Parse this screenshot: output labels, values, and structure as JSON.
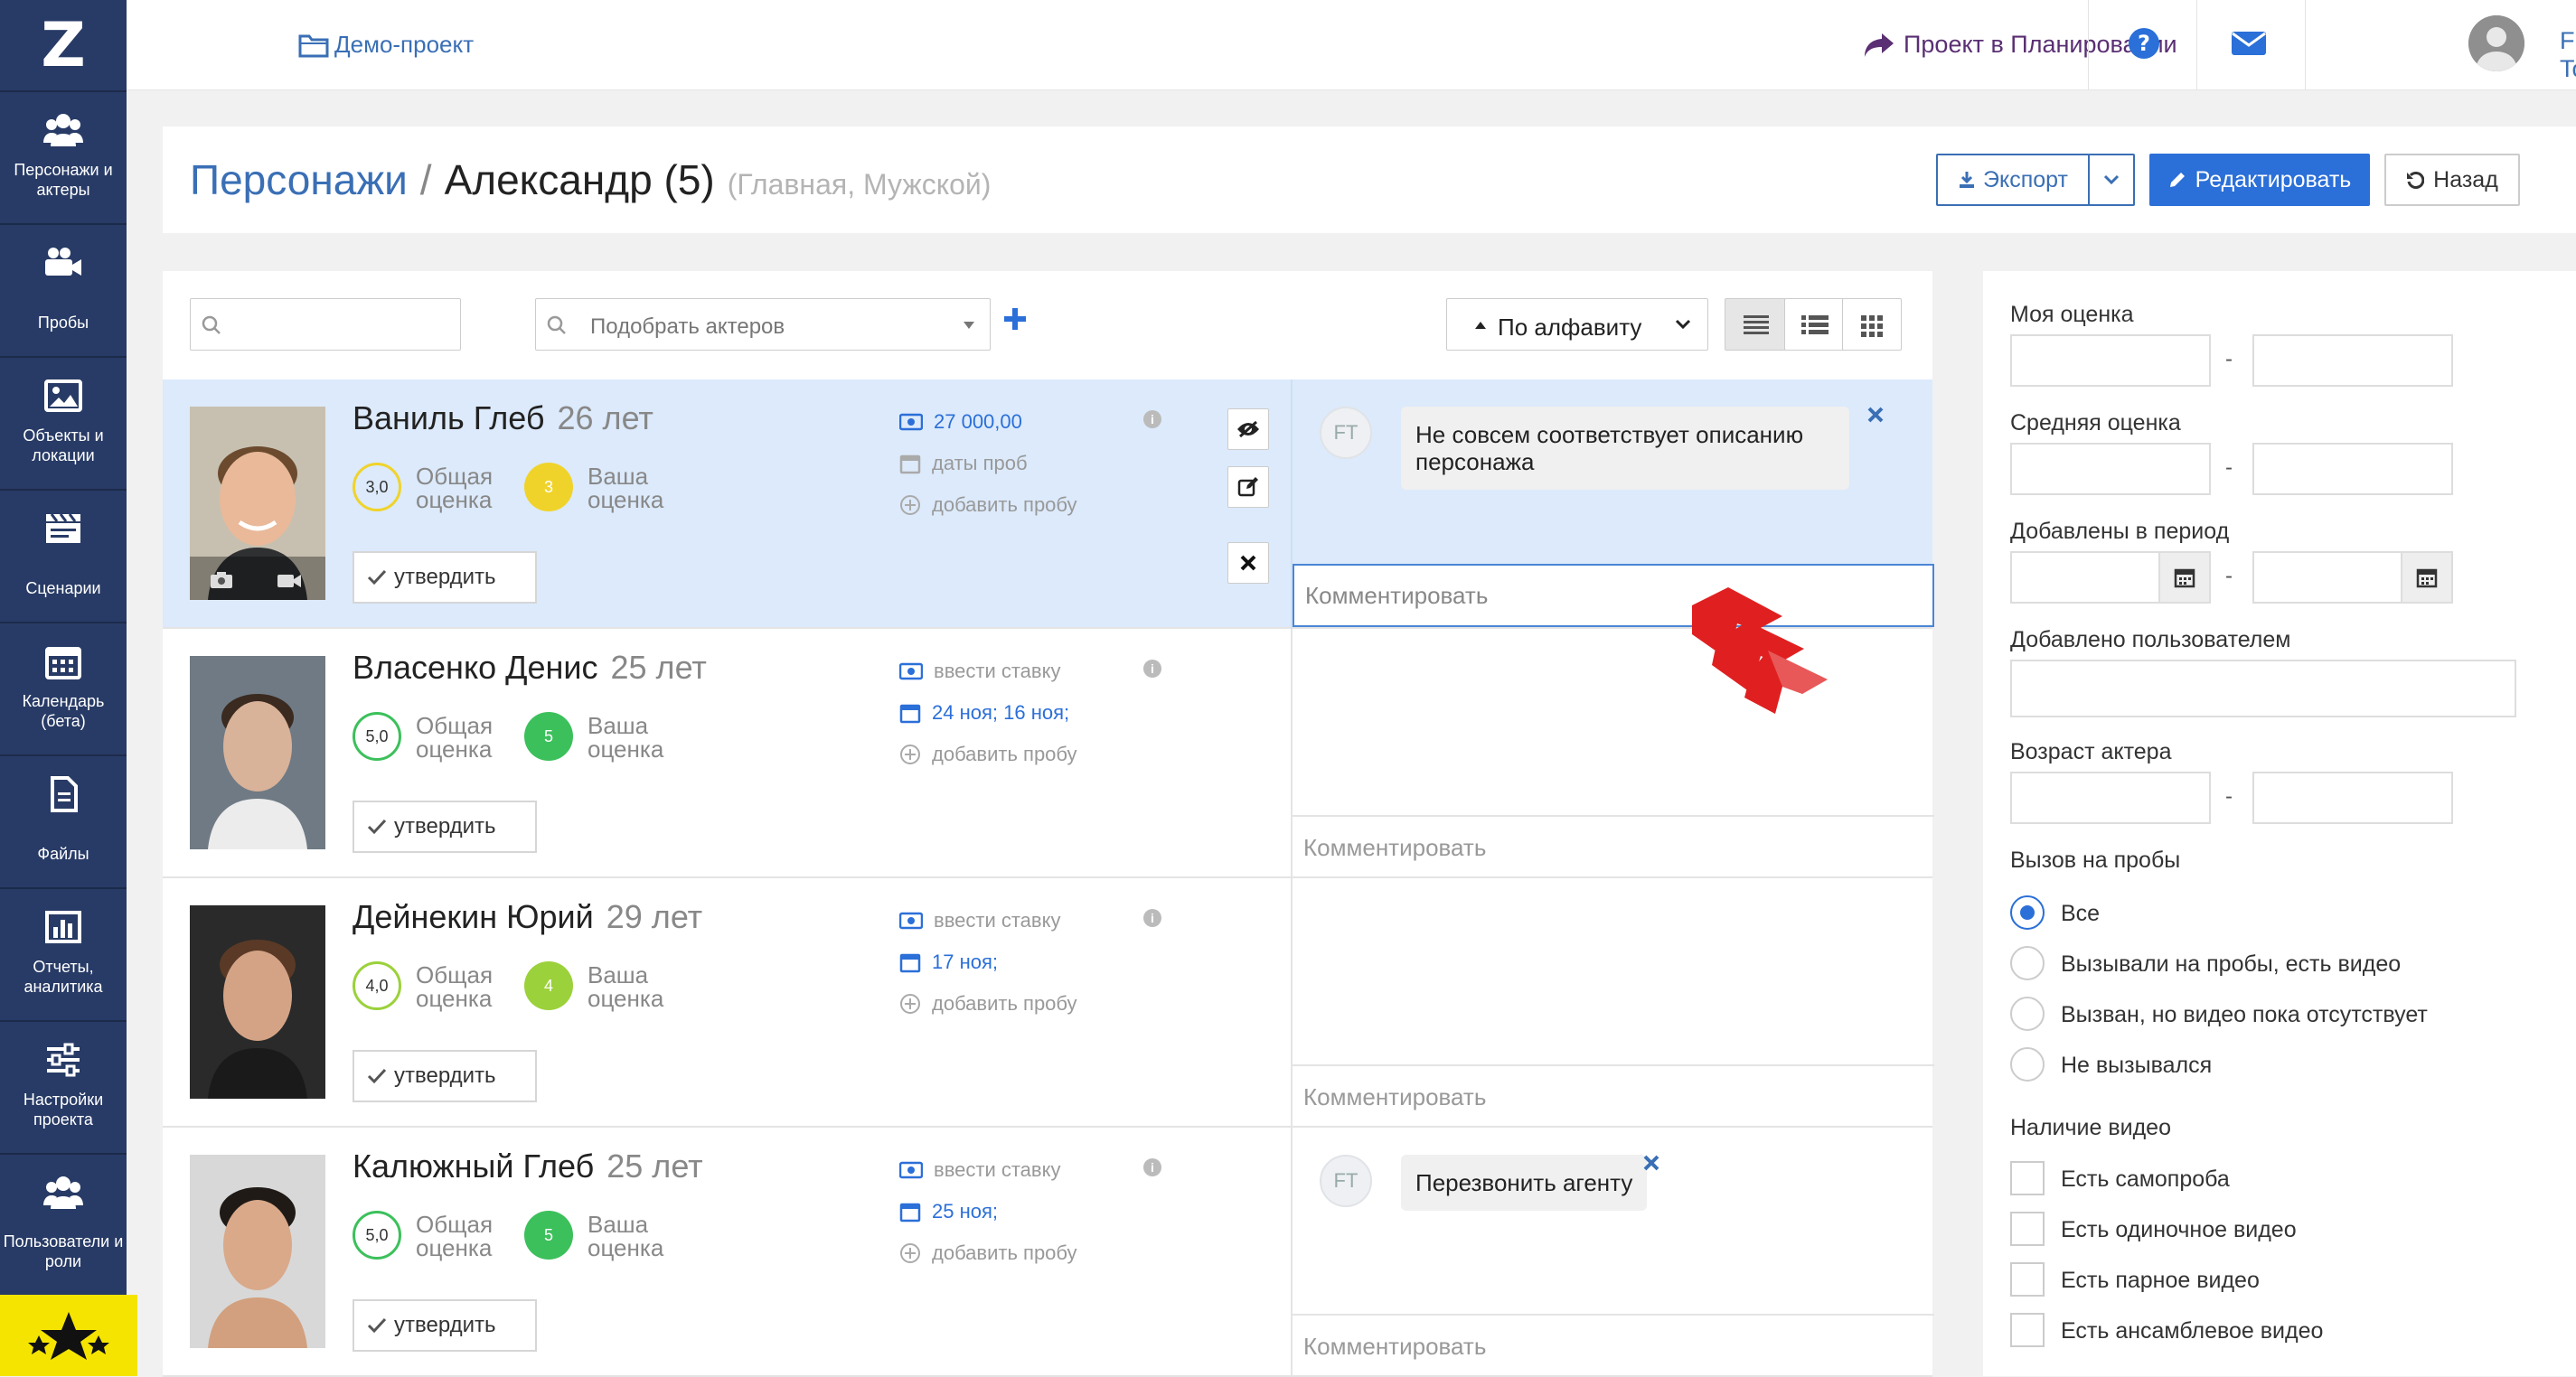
{
  "topbar": {
    "project": "Демо-проект",
    "planning": "Проект в Планировании",
    "user": "Film Toolz"
  },
  "sidebar": {
    "logo": "Z",
    "items": [
      {
        "label": "Персонажи и актеры",
        "icon": "users-icon"
      },
      {
        "label": "Пробы",
        "icon": "video-camera-icon"
      },
      {
        "label": "Объекты и локации",
        "icon": "image-icon"
      },
      {
        "label": "Сценарии",
        "icon": "clapperboard-icon"
      },
      {
        "label": "Календарь (бета)",
        "icon": "calendar-icon"
      },
      {
        "label": "Файлы",
        "icon": "file-icon"
      },
      {
        "label": "Отчеты, аналитика",
        "icon": "bar-chart-icon"
      },
      {
        "label": "Настройки проекта",
        "icon": "sliders-icon"
      },
      {
        "label": "Пользователи и роли",
        "icon": "users-icon"
      }
    ]
  },
  "header": {
    "breadcrumb_root": "Персонажи",
    "separator": "/",
    "title": "Александр (5)",
    "subtitle": "(Главная, Мужской)",
    "export_label": "Экспорт",
    "edit_label": "Редактировать",
    "back_label": "Назад"
  },
  "toolbar": {
    "search_placeholder": "",
    "pick_placeholder": "Подобрать актеров",
    "sort_label": "По алфавиту"
  },
  "labels": {
    "overall": [
      "Общая",
      "оценка"
    ],
    "yours": [
      "Ваша",
      "оценка"
    ],
    "approve": "утвердить",
    "add_test": "добавить пробу",
    "comment": "Комментировать",
    "initials": "FT"
  },
  "actors": [
    {
      "name": "Ваниль Глеб",
      "age": "26 лет",
      "overall": "3,0",
      "yours": "3",
      "rate": "27 000,00",
      "dates": "даты проб",
      "comment": "Не совсем соответствует описанию персонажа",
      "selected": true
    },
    {
      "name": "Власенко Денис",
      "age": "25 лет",
      "overall": "5,0",
      "yours": "5",
      "rate": "ввести ставку",
      "dates": "24 ноя; 16 ноя;",
      "comment": "",
      "selected": false
    },
    {
      "name": "Дейнекин Юрий",
      "age": "29 лет",
      "overall": "4,0",
      "yours": "4",
      "rate": "ввести ставку",
      "dates": "17 ноя;",
      "comment": "",
      "selected": false
    },
    {
      "name": "Калюжный Глеб",
      "age": "25 лет",
      "overall": "5,0",
      "yours": "5",
      "rate": "ввести ставку",
      "dates": "25 ноя;",
      "comment": "Перезвонить агенту",
      "selected": false
    }
  ],
  "filters": {
    "my_rating": "Моя оценка",
    "avg_rating": "Средняя оценка",
    "added_period": "Добавлены в период",
    "added_by": "Добавлено пользователем",
    "actor_age": "Возраст актера",
    "range_sep": "-",
    "call_title": "Вызов на пробы",
    "call_options": [
      "Все",
      "Вызывали на пробы, есть видео",
      "Вызван, но видео пока отсутствует",
      "Не вызывался"
    ],
    "call_selected": 0,
    "video_title": "Наличие видео",
    "video_options": [
      "Есть самопроба",
      "Есть одиночное видео",
      "Есть парное видео",
      "Есть ансамблевое видео"
    ]
  },
  "colors": {
    "sidebar": "#283b66",
    "accent": "#2b6fd8",
    "link": "#3a6fb5",
    "selected_row": "#dceafb",
    "rating_3": "#f0d32a",
    "rating_4": "#9bd13a",
    "rating_5": "#3cc05b"
  }
}
